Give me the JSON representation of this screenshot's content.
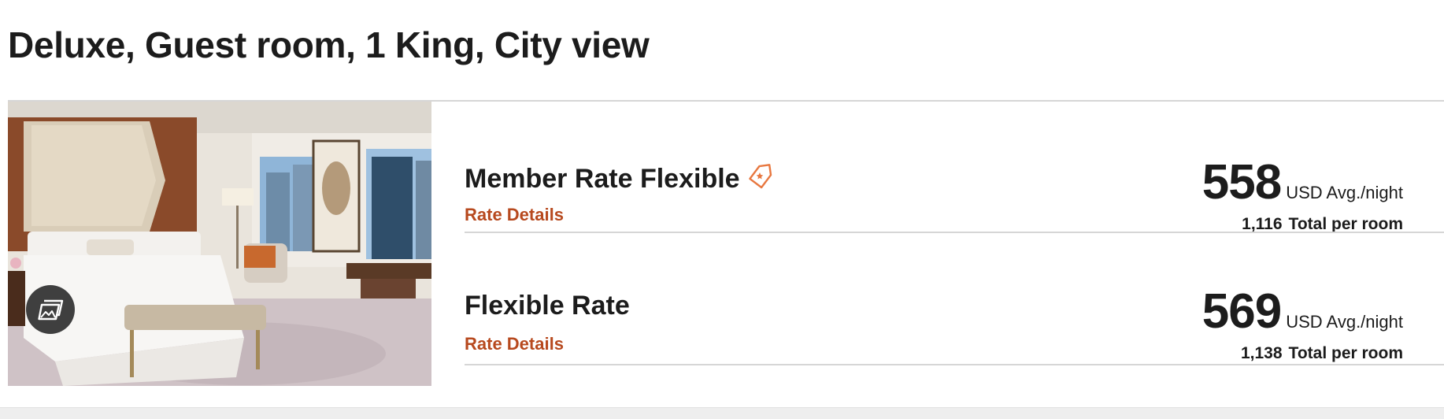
{
  "room": {
    "title": "Deluxe, Guest room, 1 King, City view"
  },
  "photo": {
    "gallery_icon": "photo-gallery-icon"
  },
  "rates": [
    {
      "name": "Member Rate Flexible",
      "has_member_tag": true,
      "tag_icon": "price-tag-icon",
      "details_label": "Rate Details",
      "price": "558",
      "price_unit": "USD Avg./night",
      "total_amount": "1,116",
      "total_label": "Total per room"
    },
    {
      "name": "Flexible Rate",
      "has_member_tag": false,
      "details_label": "Rate Details",
      "price": "569",
      "price_unit": "USD Avg./night",
      "total_amount": "1,138",
      "total_label": "Total per room"
    }
  ],
  "colors": {
    "accent": "#b7491e",
    "tag": "#e8773f",
    "text": "#1c1c1c",
    "divider": "#d6d6d6"
  }
}
